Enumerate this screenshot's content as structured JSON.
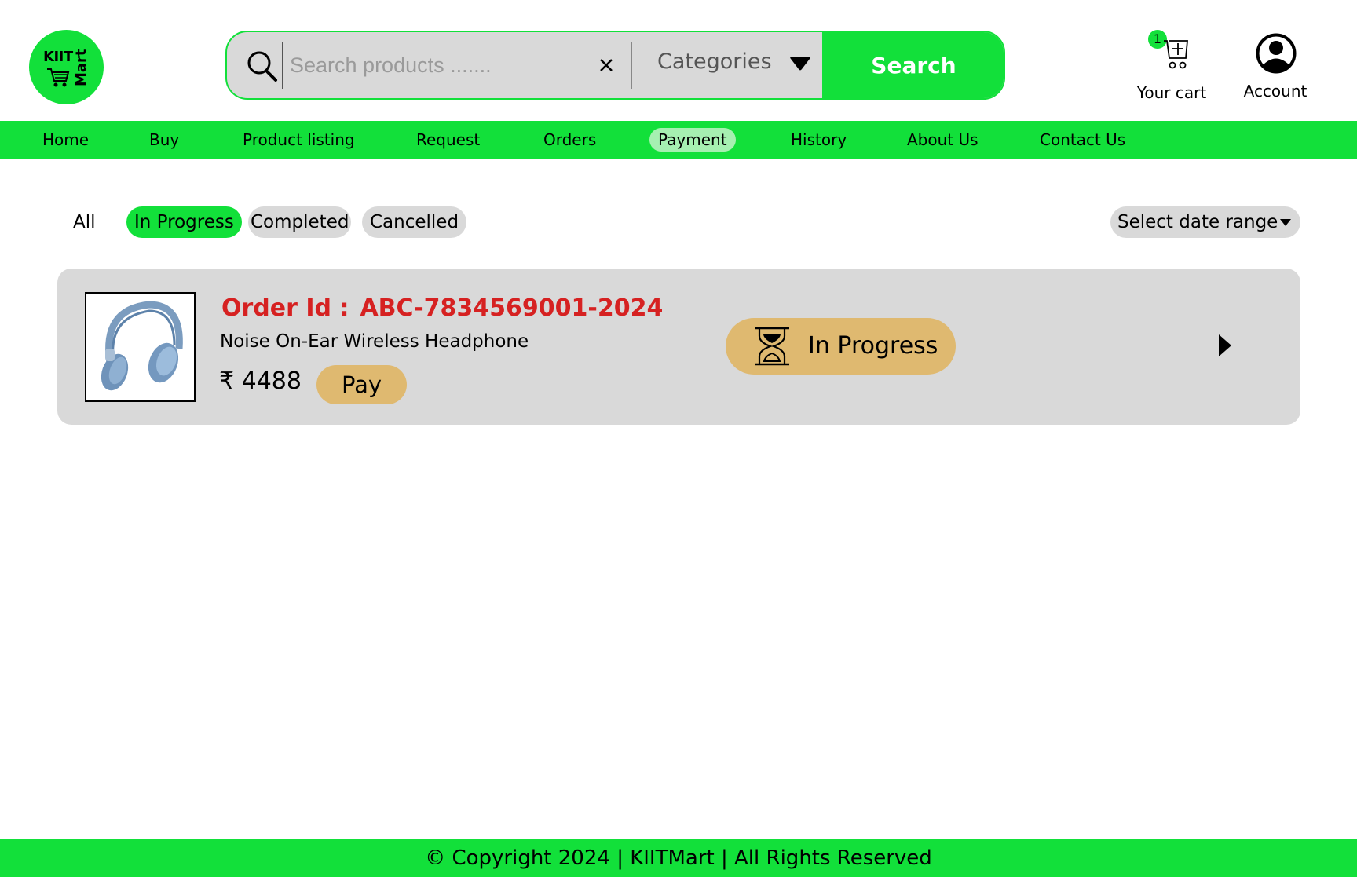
{
  "brand": {
    "logo_line1": "KIIT",
    "logo_line2": "Mart"
  },
  "search": {
    "placeholder": "Search products .......",
    "categories_label": "Categories",
    "button_label": "Search"
  },
  "cart": {
    "badge_count": "1",
    "label": "Your cart"
  },
  "account": {
    "label": "Account"
  },
  "nav": {
    "items": [
      {
        "label": "Home"
      },
      {
        "label": "Buy"
      },
      {
        "label": "Product listing"
      },
      {
        "label": "Request"
      },
      {
        "label": "Orders"
      },
      {
        "label": "Payment",
        "active": true
      },
      {
        "label": "History"
      },
      {
        "label": "About Us"
      },
      {
        "label": "Contact Us"
      }
    ]
  },
  "filters": {
    "tabs": [
      {
        "label": "All"
      },
      {
        "label": "In Progress",
        "active": true
      },
      {
        "label": "Completed"
      },
      {
        "label": "Cancelled"
      }
    ],
    "date_range_label": "Select date range"
  },
  "order": {
    "id_label": "Order Id :",
    "id_value": "ABC-7834569001-2024",
    "product_name": "Noise On-Ear Wireless Headphone",
    "price": "₹ 4488",
    "pay_label": "Pay",
    "status": "In Progress"
  },
  "footer": {
    "text": "© Copyright 2024 | KIITMart | All Rights Reserved"
  },
  "colors": {
    "brand_green": "#12e03a",
    "order_id_red": "#d62121",
    "status_tan": "#dfb970",
    "card_grey": "#d9d9d9"
  }
}
